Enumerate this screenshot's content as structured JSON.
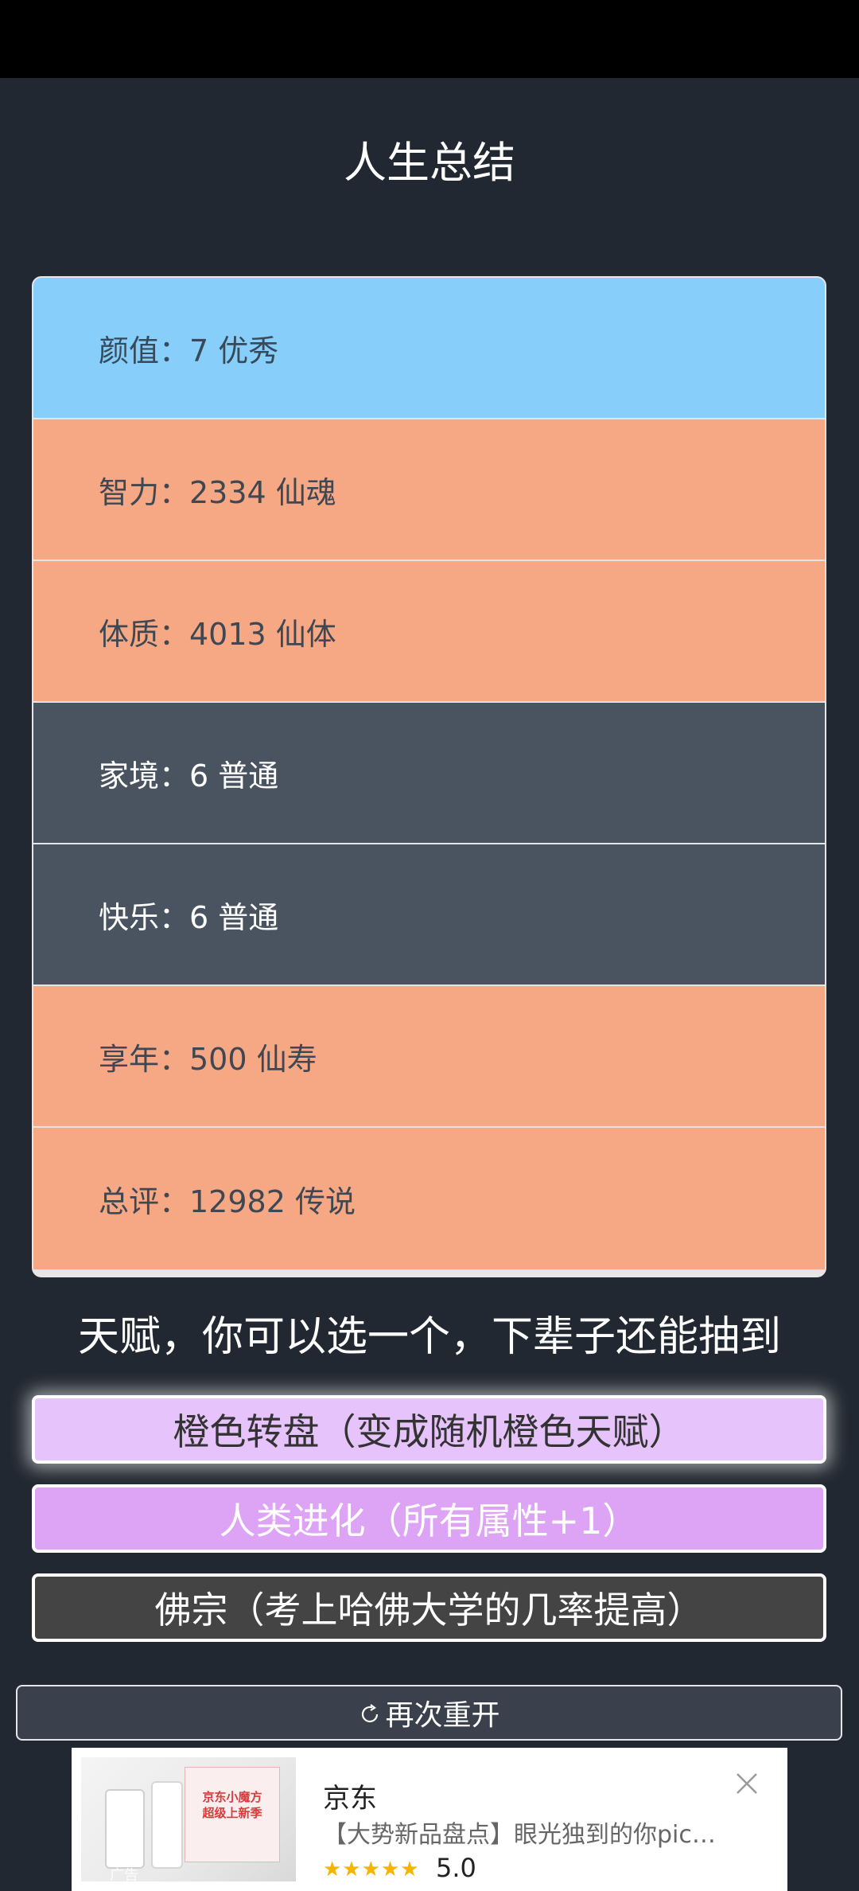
{
  "header": {
    "title": "人生总结"
  },
  "summary": {
    "rows": [
      {
        "label": "颜值：7 优秀",
        "tone": "blue"
      },
      {
        "label": "智力：2334 仙魂",
        "tone": "orange"
      },
      {
        "label": "体质：4013 仙体",
        "tone": "orange"
      },
      {
        "label": "家境：6 普通",
        "tone": "dark"
      },
      {
        "label": "快乐：6 普通",
        "tone": "dark"
      },
      {
        "label": "享年：500 仙寿",
        "tone": "orange"
      },
      {
        "label": "总评：12982 传说",
        "tone": "orange"
      }
    ]
  },
  "talents": {
    "heading": "天赋，你可以选一个，下辈子还能抽到",
    "options": [
      {
        "label": "橙色转盘（变成随机橙色天赋）",
        "selected": true
      },
      {
        "label": "人类进化（所有属性+1）",
        "selected": false
      },
      {
        "label": "佛宗（考上哈佛大学的几率提高）",
        "selected": false
      }
    ]
  },
  "restart": {
    "label": "再次重开",
    "icon": "refresh-icon"
  },
  "ad": {
    "brand": "京东",
    "text": "【大势新品盘点】眼光独到的你pic…",
    "stars": "★★★★★",
    "rating": "5.0",
    "image_text": "京东小魔方\n超级上新季",
    "tag": "广告",
    "close_icon": "close-icon"
  },
  "colors": {
    "background": "#222831",
    "row_blue": "#87cefa",
    "row_orange": "#f6a885",
    "row_dark": "#4a5461",
    "talent_selected": "#e6c3fb",
    "talent_purple": "#dda3f5",
    "talent_gray": "#444444"
  }
}
